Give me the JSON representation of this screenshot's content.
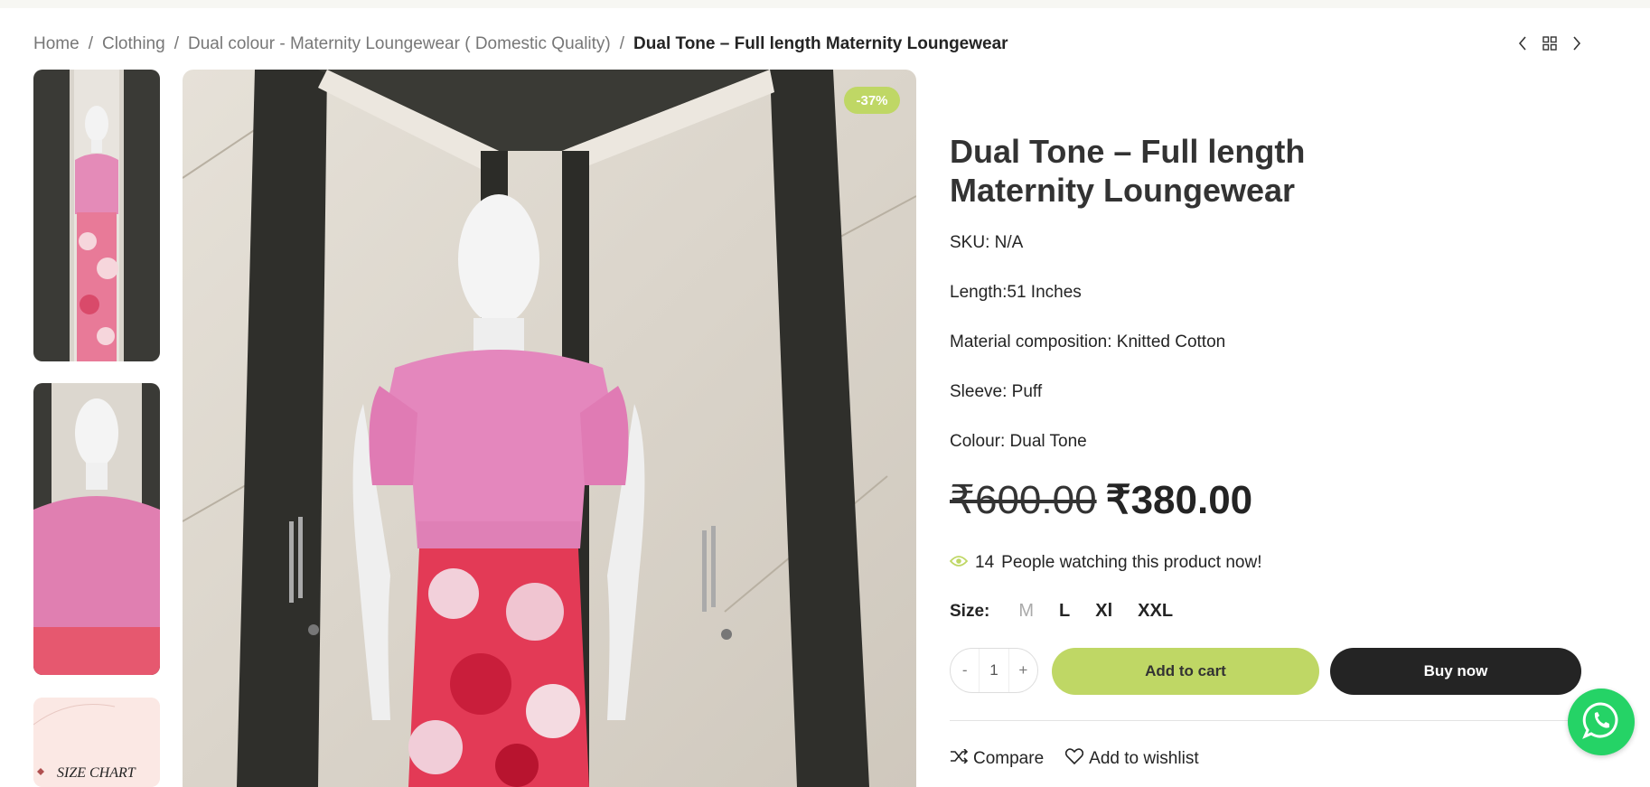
{
  "breadcrumb": {
    "home": "Home",
    "sep": "/",
    "clothing": "Clothing",
    "category": "Dual colour - Maternity Loungewear ( Domestic Quality)",
    "current": "Dual Tone – Full length Maternity Loungewear"
  },
  "badge": "-37%",
  "thumbs": {
    "size_chart_text": "SIZE CHART"
  },
  "product": {
    "title": "Dual Tone – Full length Maternity Loungewear",
    "sku_label": "SKU:",
    "sku_value": "N/A",
    "length": "Length:51 Inches",
    "material": "Material composition: Knitted Cotton",
    "sleeve": "Sleeve: Puff",
    "colour": "Colour: Dual Tone",
    "price_old": "₹600.00",
    "price_new": "₹380.00",
    "watch_count": "14",
    "watch_text": "People watching this product now!",
    "size_label": "Size",
    "size_colon": ":",
    "sizes": [
      "M",
      "L",
      "Xl",
      "XXL"
    ],
    "qty_minus": "-",
    "qty_value": "1",
    "qty_plus": "+",
    "add_to_cart": "Add to cart",
    "buy_now": "Buy now",
    "compare": "Compare",
    "wishlist": "Add to wishlist"
  },
  "colors": {
    "accent": "#bfd765",
    "dark": "#242424",
    "whatsapp": "#25d366"
  },
  "icons": [
    "prev-arrow-icon",
    "grid-icon",
    "next-arrow-icon",
    "eye-icon",
    "compare-icon",
    "heart-icon",
    "whatsapp-icon"
  ]
}
